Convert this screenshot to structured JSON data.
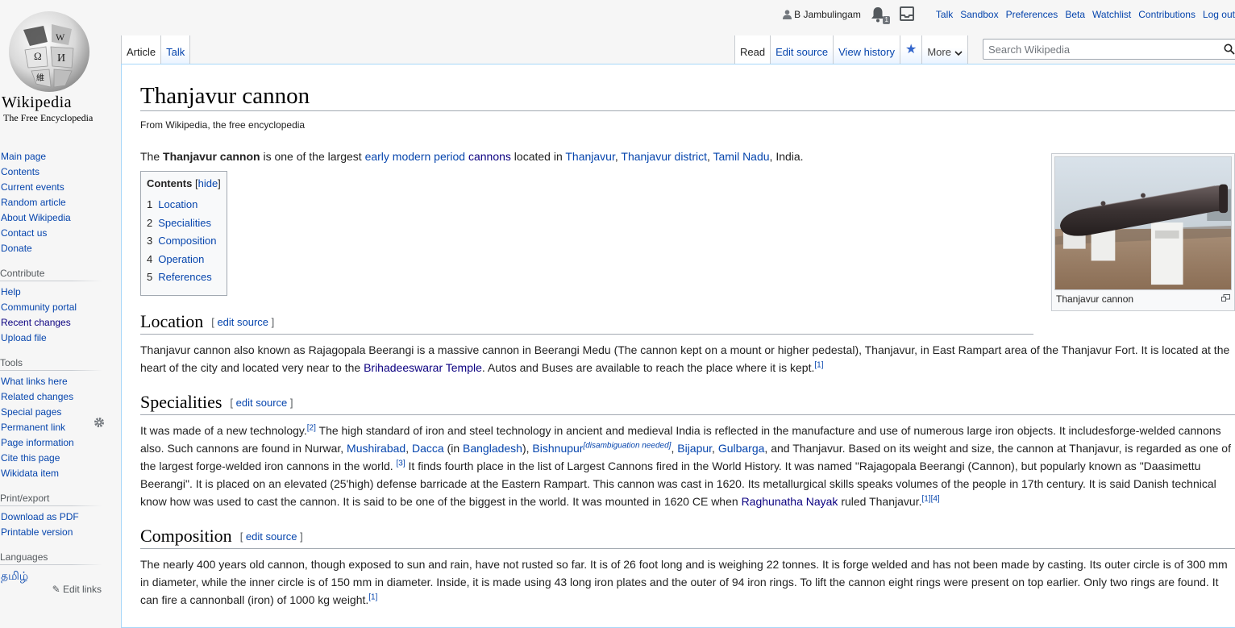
{
  "logo": {
    "wordmark": "Wikipedia",
    "tagline": "The Free Encyclopedia"
  },
  "personal": {
    "username": "B Jambulingam",
    "notifications_count": "1",
    "links": [
      "Talk",
      "Sandbox",
      "Preferences",
      "Beta",
      "Watchlist",
      "Contributions",
      "Log out"
    ]
  },
  "tabs": {
    "left": [
      "Article",
      "Talk"
    ],
    "read": "Read",
    "edit_source": "Edit source",
    "view_history": "View history",
    "more": "More"
  },
  "search": {
    "placeholder": "Search Wikipedia"
  },
  "sidebar": {
    "navigation": [
      "Main page",
      "Contents",
      "Current events",
      "Random article",
      "About Wikipedia",
      "Contact us",
      "Donate"
    ],
    "contribute": {
      "heading": "Contribute",
      "items": [
        "Help",
        "Community portal",
        "Recent changes",
        "Upload file"
      ]
    },
    "tools": {
      "heading": "Tools",
      "items": [
        "What links here",
        "Related changes",
        "Special pages",
        "Permanent link",
        "Page information",
        "Cite this page",
        "Wikidata item"
      ]
    },
    "print": {
      "heading": "Print/export",
      "items": [
        "Download as PDF",
        "Printable version"
      ]
    },
    "languages": {
      "heading": "Languages",
      "items": [
        "தமிழ்"
      ],
      "edit_links": "Edit links"
    }
  },
  "article": {
    "title": "Thanjavur cannon",
    "site_sub": "From Wikipedia, the free encyclopedia",
    "lead": {
      "t1": "The ",
      "bold": "Thanjavur cannon",
      "t2": " is one of the largest ",
      "l1": "early modern period",
      "t3": " ",
      "l2": "cannons",
      "t4": " located in ",
      "l3": "Thanjavur",
      "t5": ", ",
      "l4": "Thanjavur district",
      "t6": ", ",
      "l5": "Tamil Nadu",
      "t7": ", India."
    },
    "thumb": {
      "caption": "Thanjavur cannon"
    },
    "toc": {
      "title": "Contents",
      "hide": "hide",
      "entries": [
        {
          "num": "1",
          "label": "Location"
        },
        {
          "num": "2",
          "label": "Specialities"
        },
        {
          "num": "3",
          "label": "Composition"
        },
        {
          "num": "4",
          "label": "Operation"
        },
        {
          "num": "5",
          "label": "References"
        }
      ]
    },
    "edit_source": "edit source",
    "location": {
      "heading": "Location",
      "t1": "Thanjavur cannon also known as Rajagopala Beerangi is a massive cannon in Beerangi Medu (The cannon kept on a mount or higher pedestal), Thanjavur, in East Rampart area of the Thanjavur Fort. It is located at the heart of the city and located very near to the ",
      "l1": "Brihadeeswarar Temple",
      "t2": ". Autos and Buses are available to reach the place where it is kept.",
      "ref": "[1]"
    },
    "specialities": {
      "heading": "Specialities",
      "t1": "It was made of a new technology.",
      "ref1": "[2]",
      "t2": " The high standard of iron and steel technology in ancient and medieval India is reflected in the manufacture and use of numerous large iron objects. It includesforge-welded cannons also. Such cannons are found in Nurwar, ",
      "l1": "Mushirabad",
      "t3": ", ",
      "l2": "Dacca",
      "t4": " (in ",
      "l3": "Bangladesh",
      "t5": "), ",
      "l4": "Bishnupur",
      "dab": "[disambiguation needed]",
      "t6": ", ",
      "l5": "Bijapur",
      "t7": ", ",
      "l6": "Gulbarga",
      "t8": ", and Thanjavur. Based on its weight and size, the cannon at Thanjavur, is regarded as one of the largest forge-welded iron cannons in the world. ",
      "ref2": "[3]",
      "t9": " It finds fourth place in the list of Largest Cannons fired in the World History. It was named \"Rajagopala Beerangi (Cannon), but popularly known as \"Daasimettu Beerangi\". It is placed on an elevated (25'high) defense barricade at the Eastern Rampart. This cannon was cast in 1620. Its metallurgical skills speaks volumes of the people in 17th century. It is said Danish technical know how was used to cast the cannon. It is said to be one of the biggest in the world. It was mounted in 1620 CE when ",
      "l7": "Raghunatha Nayak",
      "t10": " ruled Thanjavur.",
      "ref3": "[1]",
      "ref4": "[4]"
    },
    "composition": {
      "heading": "Composition",
      "t1": "The nearly 400 years old cannon, though exposed to sun and rain, have not rusted so far. It is of 26 foot long and is weighing 22 tonnes. It is forge welded and has not been made by casting. Its outer circle is of 300 mm in diameter, while the inner circle is of 150 mm in diameter. Inside, it is made using 43 long iron plates and the outer of 94 iron rings. To lift the cannon eight rings were present on top earlier. Only two rings are found. It can fire a cannonball (iron) of 1000 kg weight.",
      "ref": "[1]"
    }
  },
  "colors": {
    "link": "#0645ad",
    "visited": "#0b0080",
    "border": "#a7d7f9",
    "text": "#222222"
  }
}
